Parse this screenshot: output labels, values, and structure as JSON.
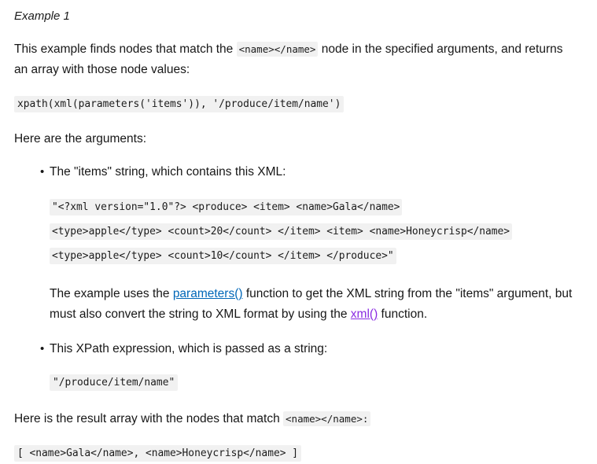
{
  "page": {
    "heading": "Example 1",
    "intro": {
      "before_code": "This example finds nodes that match the ",
      "code": "<name></name>",
      "after_code": " node in the specified arguments, and returns an array with those node values:"
    },
    "expression_code": "xpath(xml(parameters('items')), '/produce/item/name')",
    "arguments_label": "Here are the arguments:",
    "bullets": [
      {
        "text": "The \"items\" string, which contains this XML:",
        "code_sample": "\"<?xml version=\"1.0\"?> <produce> <item> <name>Gala</name> <type>apple</type> <count>20</count> </item> <item> <name>Honeycrisp</name> <type>apple</type> <count>10</count> </item> </produce>\"",
        "note": {
          "part1": "The example uses the ",
          "link1": "parameters()",
          "part2": " function to get the XML string from the \"items\" argument, but must also convert the string to XML format by using the ",
          "link2": "xml()",
          "part3": " function."
        }
      },
      {
        "text": "This XPath expression, which is passed as a string:",
        "code_sample": "\"/produce/item/name\""
      }
    ],
    "result": {
      "before_code": "Here is the result array with the nodes that match ",
      "code": "<name></name>:",
      "array_code": "[ <name>Gala</name>, <name>Honeycrisp</name> ]"
    },
    "colors": {
      "link": "#0067b8",
      "visited_link": "#8a2be2",
      "code_background": "#f1f1f1",
      "text": "#171717"
    }
  }
}
